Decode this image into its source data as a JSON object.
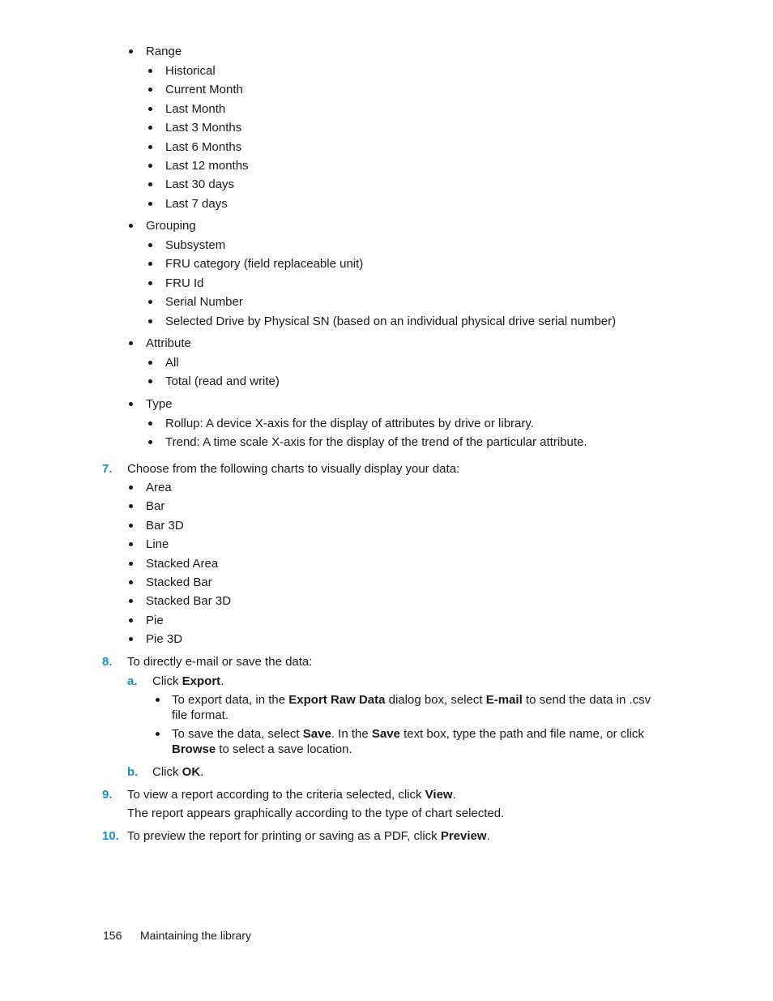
{
  "lists": {
    "range": {
      "label": "Range",
      "items": [
        "Historical",
        "Current Month",
        "Last Month",
        "Last 3 Months",
        "Last 6 Months",
        "Last 12 months",
        "Last 30 days",
        "Last 7 days"
      ]
    },
    "grouping": {
      "label": "Grouping",
      "items": [
        "Subsystem",
        "FRU category (field replaceable unit)",
        "FRU Id",
        "Serial Number",
        "Selected Drive by Physical SN (based on an individual physical drive serial number)"
      ]
    },
    "attribute": {
      "label": "Attribute",
      "items": [
        "All",
        "Total (read and write)"
      ]
    },
    "type": {
      "label": "Type",
      "items": [
        "Rollup: A device X-axis for the display of attributes by drive or library.",
        "Trend: A time scale X-axis for the display of the trend of the particular attribute."
      ]
    }
  },
  "steps": {
    "s7": {
      "number": "7.",
      "text": "Choose from the following charts to visually display your data:",
      "charts": [
        "Area",
        "Bar",
        "Bar 3D",
        "Line",
        "Stacked Area",
        "Stacked Bar",
        "Stacked Bar 3D",
        "Pie",
        "Pie 3D"
      ]
    },
    "s8": {
      "number": "8.",
      "text": "To directly e-mail or save the data:",
      "a": {
        "letter": "a.",
        "pre": "Click ",
        "bold": "Export",
        "post": ".",
        "b1": {
          "t1": "To export data, in the ",
          "b1": "Export Raw Data",
          "t2": " dialog box, select ",
          "b2": "E-mail",
          "t3": " to send the data in .csv",
          "line2": "file format."
        },
        "b2": {
          "t1": "To save the data, select ",
          "b1": "Save",
          "t2": ". In the ",
          "b2": "Save",
          "t3": " text box, type the path and file name, or click",
          "line2_bold": "Browse",
          "line2_rest": " to select a save location."
        }
      },
      "b": {
        "letter": "b.",
        "pre": "Click ",
        "bold": "OK",
        "post": "."
      }
    },
    "s9": {
      "number": "9.",
      "pre": "To view a report according to the criteria selected, click ",
      "bold": "View",
      "post": ".",
      "note": "The report appears graphically according to the type of chart selected."
    },
    "s10": {
      "number": "10.",
      "pre": "To preview the report for printing or saving as a PDF, click ",
      "bold": "Preview",
      "post": "."
    }
  },
  "footer": {
    "page_number": "156",
    "section": "Maintaining the library"
  }
}
